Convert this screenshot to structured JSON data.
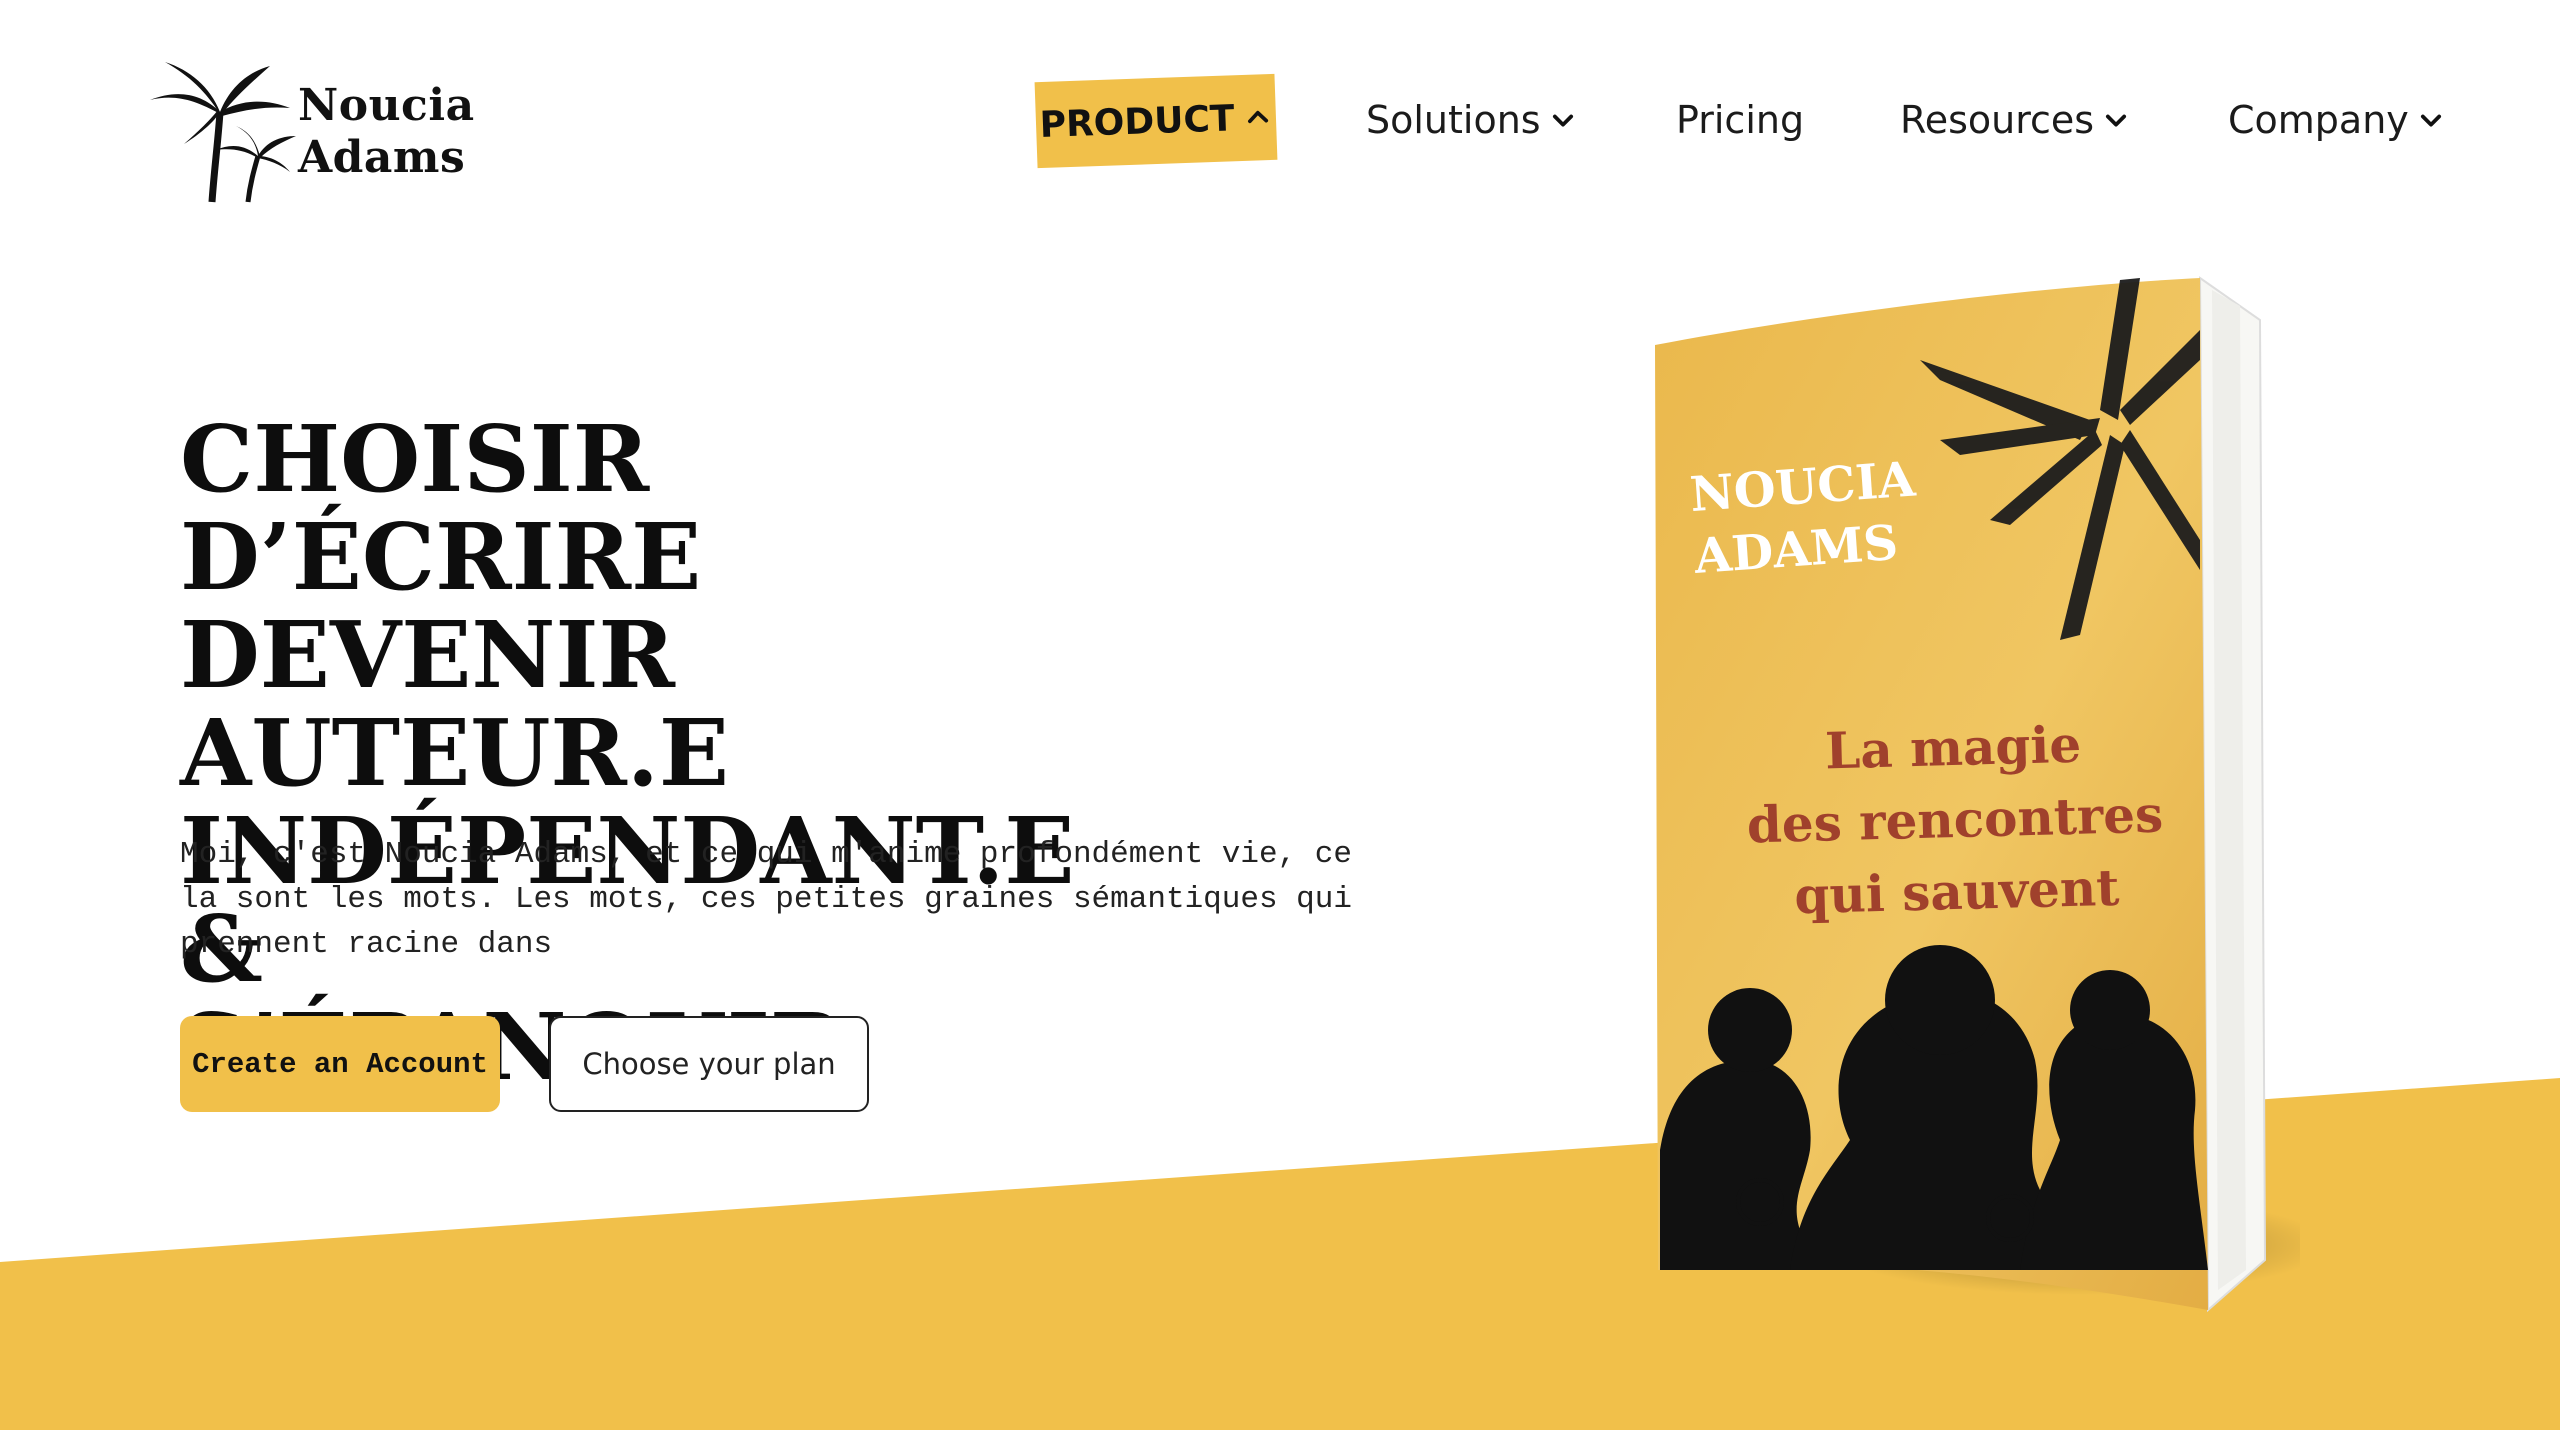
{
  "brand": {
    "name_line1": "Noucia",
    "name_line2": "Adams",
    "logo_icon": "palm-trees-icon"
  },
  "nav": {
    "product": "PRODUCT",
    "solutions": "Solutions",
    "pricing": "Pricing",
    "resources": "Resources",
    "company": "Company"
  },
  "hero": {
    "title_lines": [
      "CHOISIR D’ÉCRIRE",
      "DEVENIR AUTEUR.E",
      "INDÉPENDANT.E &",
      "S’ÉPANOUIR"
    ],
    "description_lines": [
      "Moi, c'est Noucia Adams, et ce qui m'anime profondément vie, ce",
      "la sont les mots. Les mots, ces petites graines sémantiques qui",
      "prennent racine dans"
    ],
    "primary_button": "Create an Account",
    "secondary_button": "Choose your plan"
  },
  "book": {
    "author_lines": [
      "NOUCIA",
      "ADAMS"
    ],
    "title_lines": [
      "La magie",
      "des rencontres",
      "qui sauvent"
    ]
  },
  "colors": {
    "accent": "#f1c04a",
    "book_cover": "#e9b94e",
    "book_title": "#a0412c",
    "text": "#111111",
    "background": "#ffffff"
  }
}
